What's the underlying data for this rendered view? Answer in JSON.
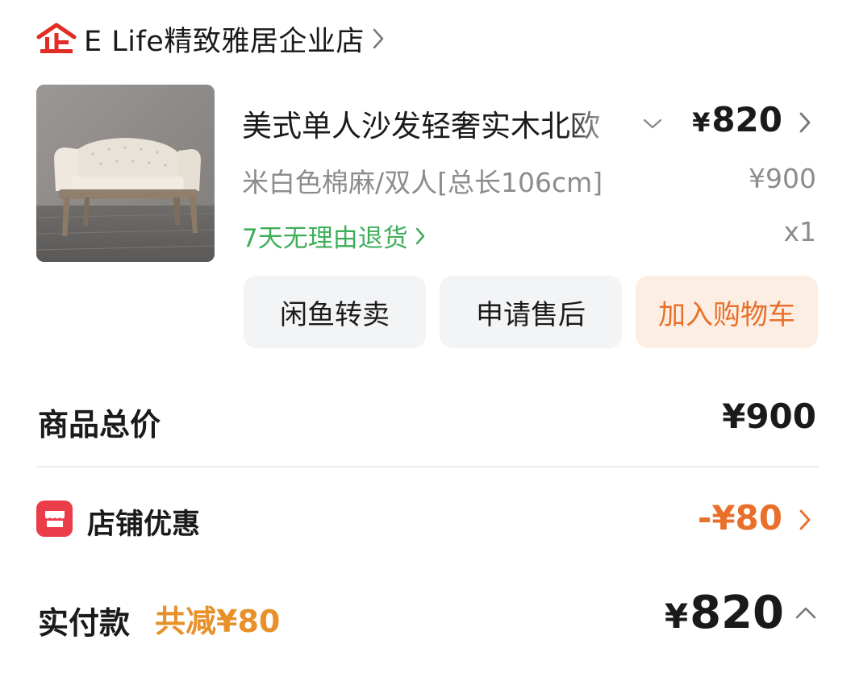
{
  "shop": {
    "name": "E Life精致雅居企业店",
    "badge_icon": "enterprise-shop-icon",
    "badge_color": "#e02e24"
  },
  "product": {
    "title": "美式单人沙发轻奢实木北欧",
    "sku": "米白色棉麻/双人[总长106cm]",
    "paid_price": "820",
    "paid_currency": "¥",
    "original_price": "¥900",
    "quantity": "x1",
    "return_policy": "7天无理由退货",
    "image": "beige-loveseat-photo"
  },
  "actions": {
    "resell_label": "闲鱼转卖",
    "aftersale_label": "申请售后",
    "add_cart_label": "加入购物车"
  },
  "summary": {
    "subtotal_label": "商品总价",
    "subtotal_value": "¥900",
    "discount_label": "店铺优惠",
    "discount_value": "-¥80",
    "actual_label": "实付款",
    "actual_saving": "共减¥80",
    "actual_currency": "¥",
    "actual_value": "820"
  },
  "colors": {
    "accent_orange": "#e8702a",
    "return_green": "#3fae5a",
    "discount_red": "#ea3c49",
    "muted_gray": "#8c8c8c"
  }
}
